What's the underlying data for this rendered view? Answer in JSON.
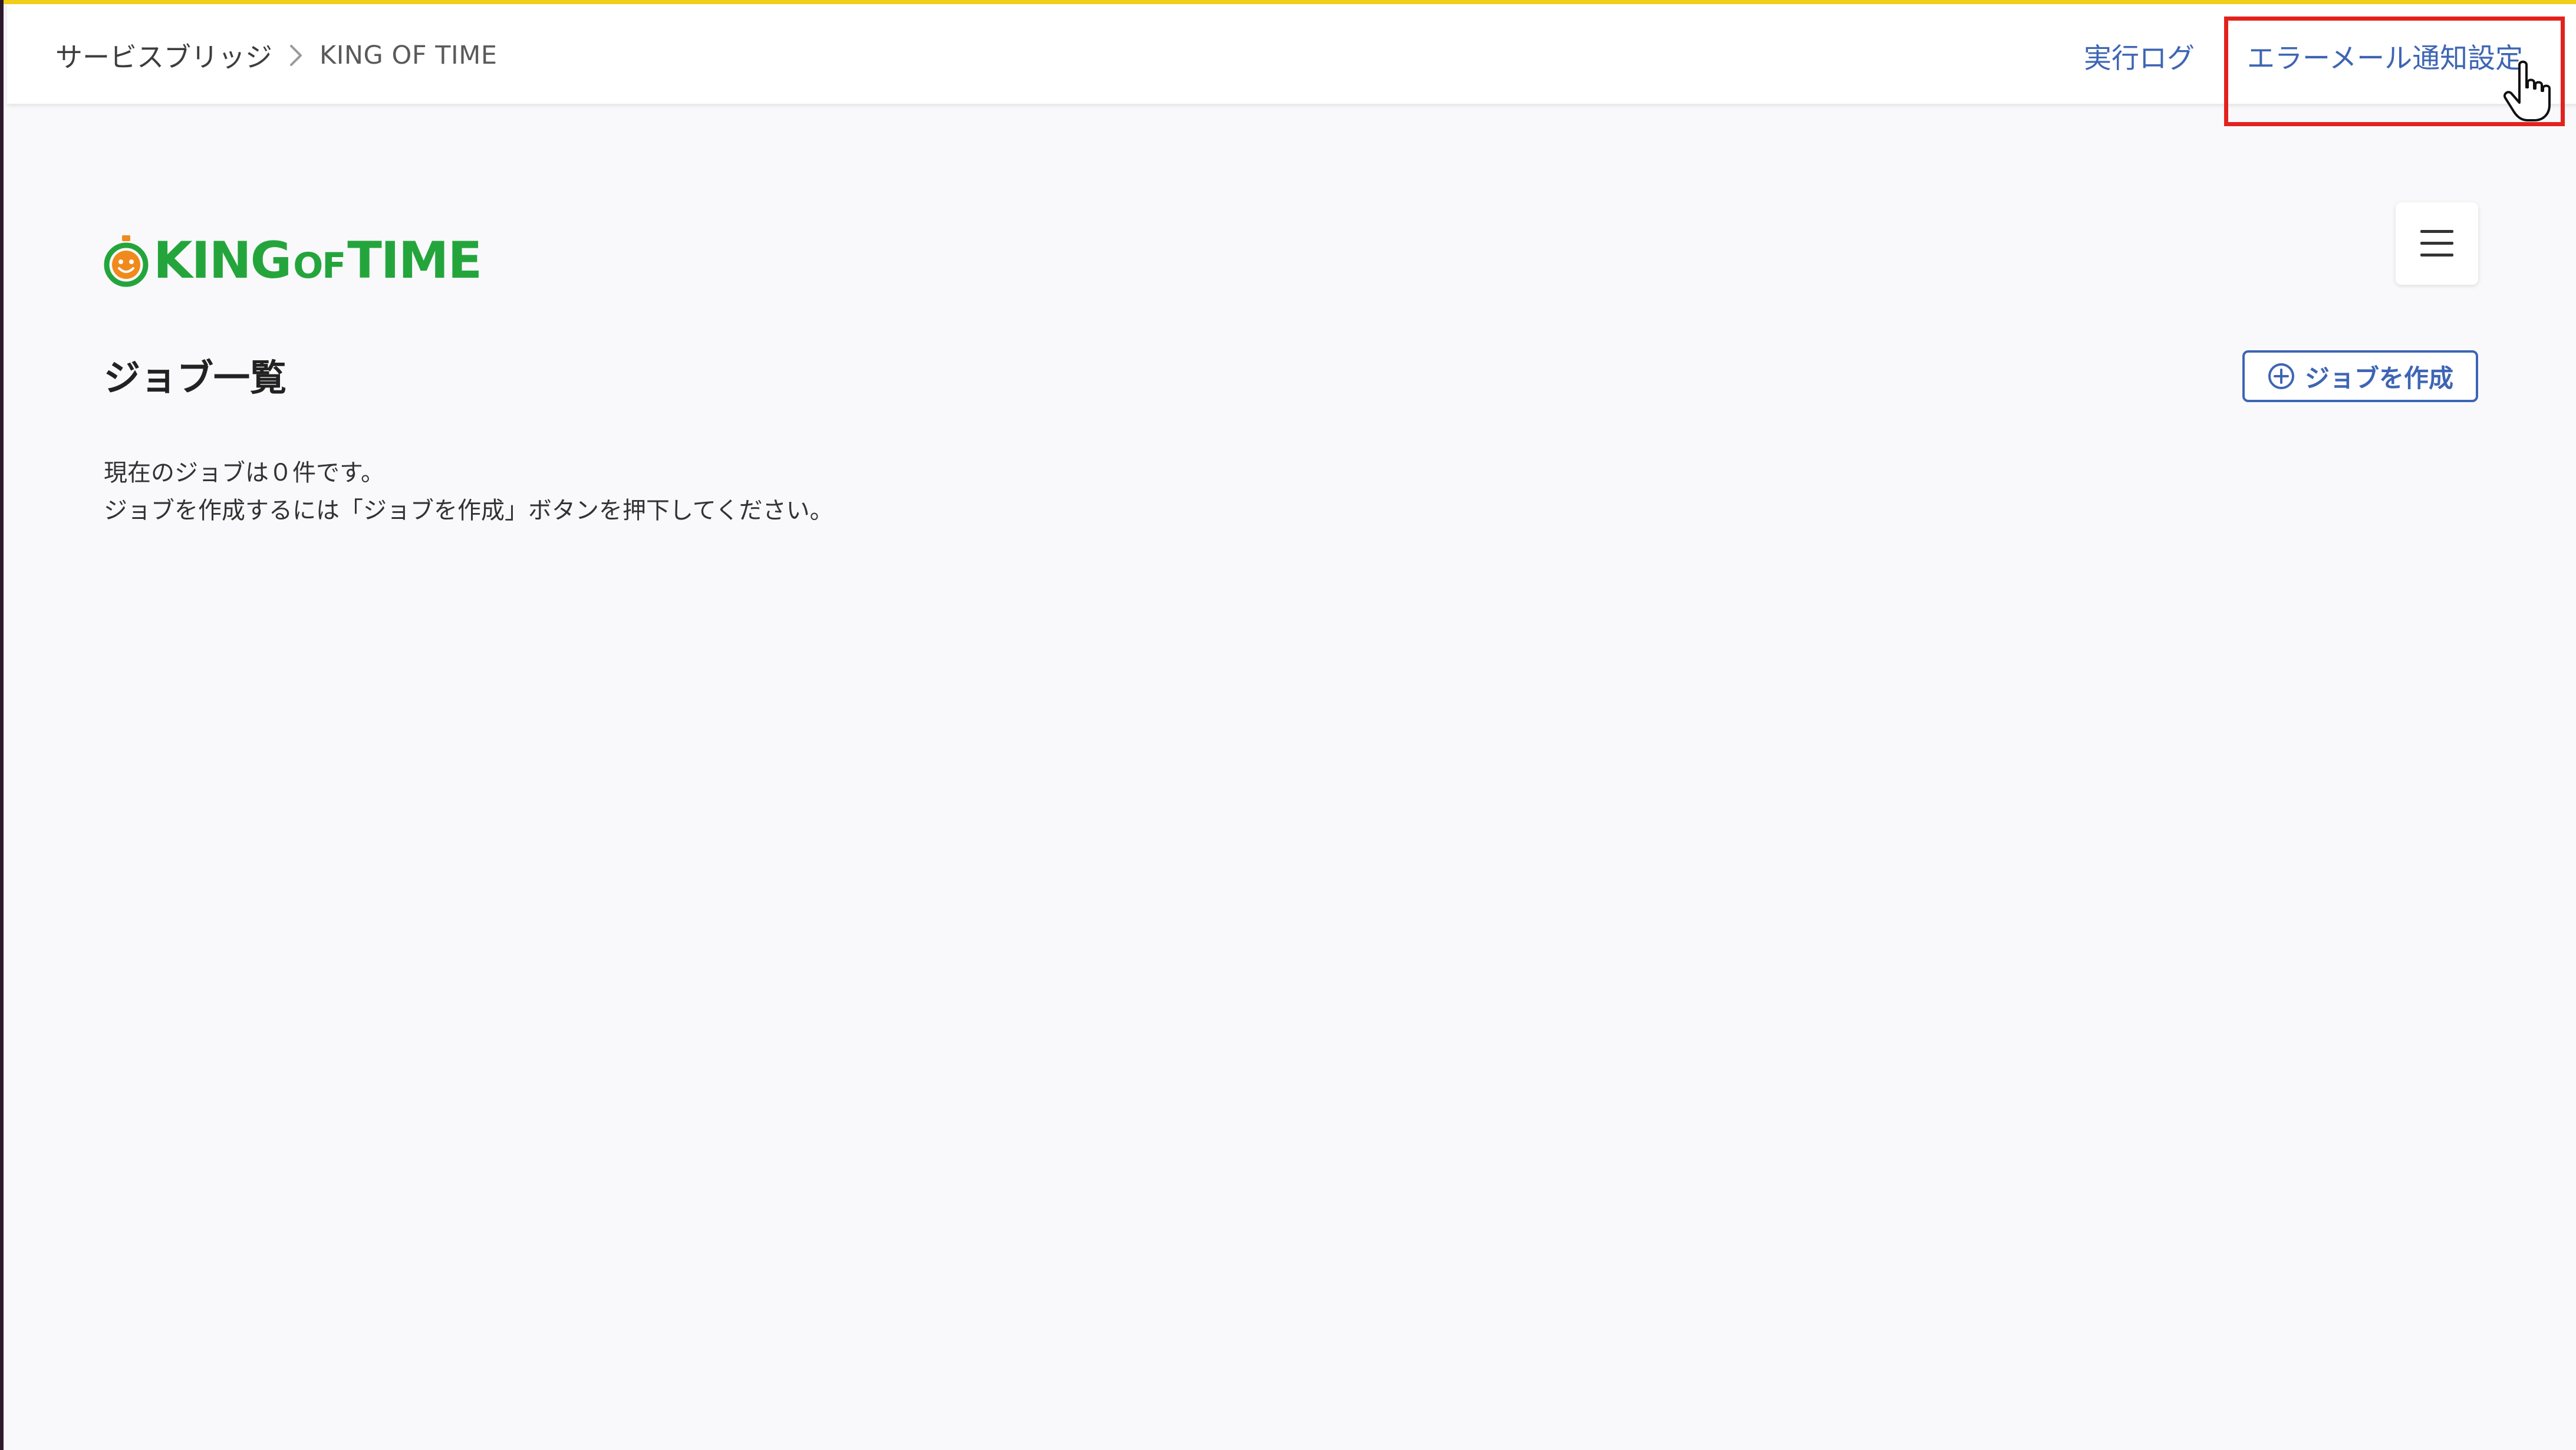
{
  "breadcrumb": {
    "root": "サービスブリッジ",
    "current": "KING OF TIME"
  },
  "header": {
    "log_link": "実行ログ",
    "notify_link": "エラーメール通知設定"
  },
  "logo": {
    "left": "KING",
    "of": "OF",
    "right": "TIME",
    "color": "#24a53c"
  },
  "page": {
    "title": "ジョブ一覧",
    "create_button": "ジョブを作成",
    "message_line1": "現在のジョブは０件です。",
    "message_line2": "ジョブを作成するには「ジョブを作成」ボタンを押下してください。"
  },
  "colors": {
    "accent": "#3e65b4",
    "highlight": "#e3221e",
    "top_bar": "#f1cf18"
  },
  "icons": {
    "breadcrumb_separator": "chevron-right-icon",
    "menu": "hamburger-icon",
    "create": "plus-circle-icon",
    "cursor": "hand-pointer-icon",
    "logo_mark": "clock-face-icon"
  }
}
